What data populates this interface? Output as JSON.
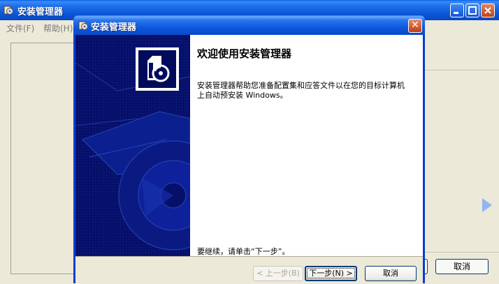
{
  "main_window": {
    "title": "安装管理器",
    "menu": [
      "文件(F)",
      "帮助(H)"
    ],
    "cancel_label": "取消"
  },
  "dialog": {
    "title": "安装管理器",
    "close_glyph": "✕",
    "heading": "欢迎使用安装管理器",
    "description": "安装管理器帮助您准备配置集和应答文件以在您的目标计算机上自动预安装 Windows。",
    "continue_text": "要继续，请单击“下一步”。",
    "buttons": {
      "back": "< 上一步(B)",
      "next": "下一步(N) >",
      "cancel": "取消"
    }
  },
  "colors": {
    "titlebar": "#0a55d6",
    "side_panel": "#06106a",
    "dialog_bg": "#ece9d8"
  },
  "icons": [
    "setup-manager-icon",
    "box-disc-icon",
    "minimize-icon",
    "maximize-icon",
    "close-icon"
  ]
}
